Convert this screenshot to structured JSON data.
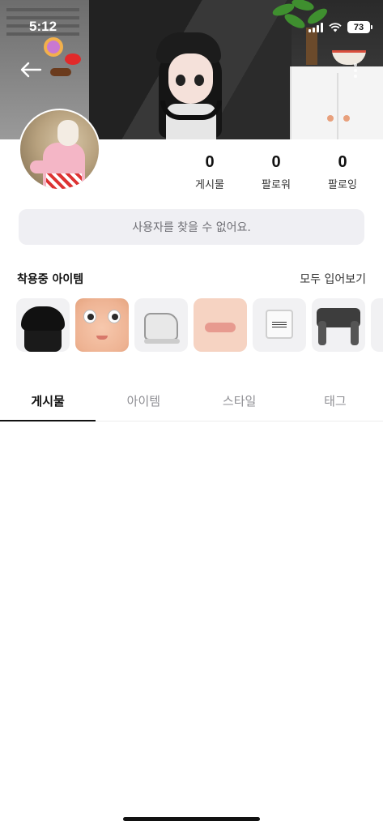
{
  "status_bar": {
    "time": "5:12",
    "battery": "73",
    "icons": [
      "cellular-signal-icon",
      "wifi-icon",
      "battery-icon"
    ]
  },
  "header": {
    "back_icon": "arrow-left-icon",
    "more_icon": "more-vertical-icon"
  },
  "profile": {
    "stats": [
      {
        "value": "0",
        "label": "게시물"
      },
      {
        "value": "0",
        "label": "팔로워"
      },
      {
        "value": "0",
        "label": "팔로잉"
      }
    ],
    "notice": "사용자를 찾을 수 없어요."
  },
  "worn_items": {
    "title": "착용중 아이템",
    "see_all": "모두 입어보기",
    "items": [
      {
        "name": "beret-hair"
      },
      {
        "name": "face"
      },
      {
        "name": "sneakers"
      },
      {
        "name": "lips"
      },
      {
        "name": "crop-top",
        "text": "COME AS YOU ARE"
      },
      {
        "name": "jacket"
      },
      {
        "name": "partial-item"
      }
    ]
  },
  "tabs": [
    {
      "label": "게시물",
      "active": true
    },
    {
      "label": "아이템",
      "active": false
    },
    {
      "label": "스타일",
      "active": false
    },
    {
      "label": "태그",
      "active": false
    }
  ],
  "colors": {
    "notice_bg": "#efeff3",
    "active_tab": "#111111",
    "inactive_tab": "#8e8e93"
  }
}
